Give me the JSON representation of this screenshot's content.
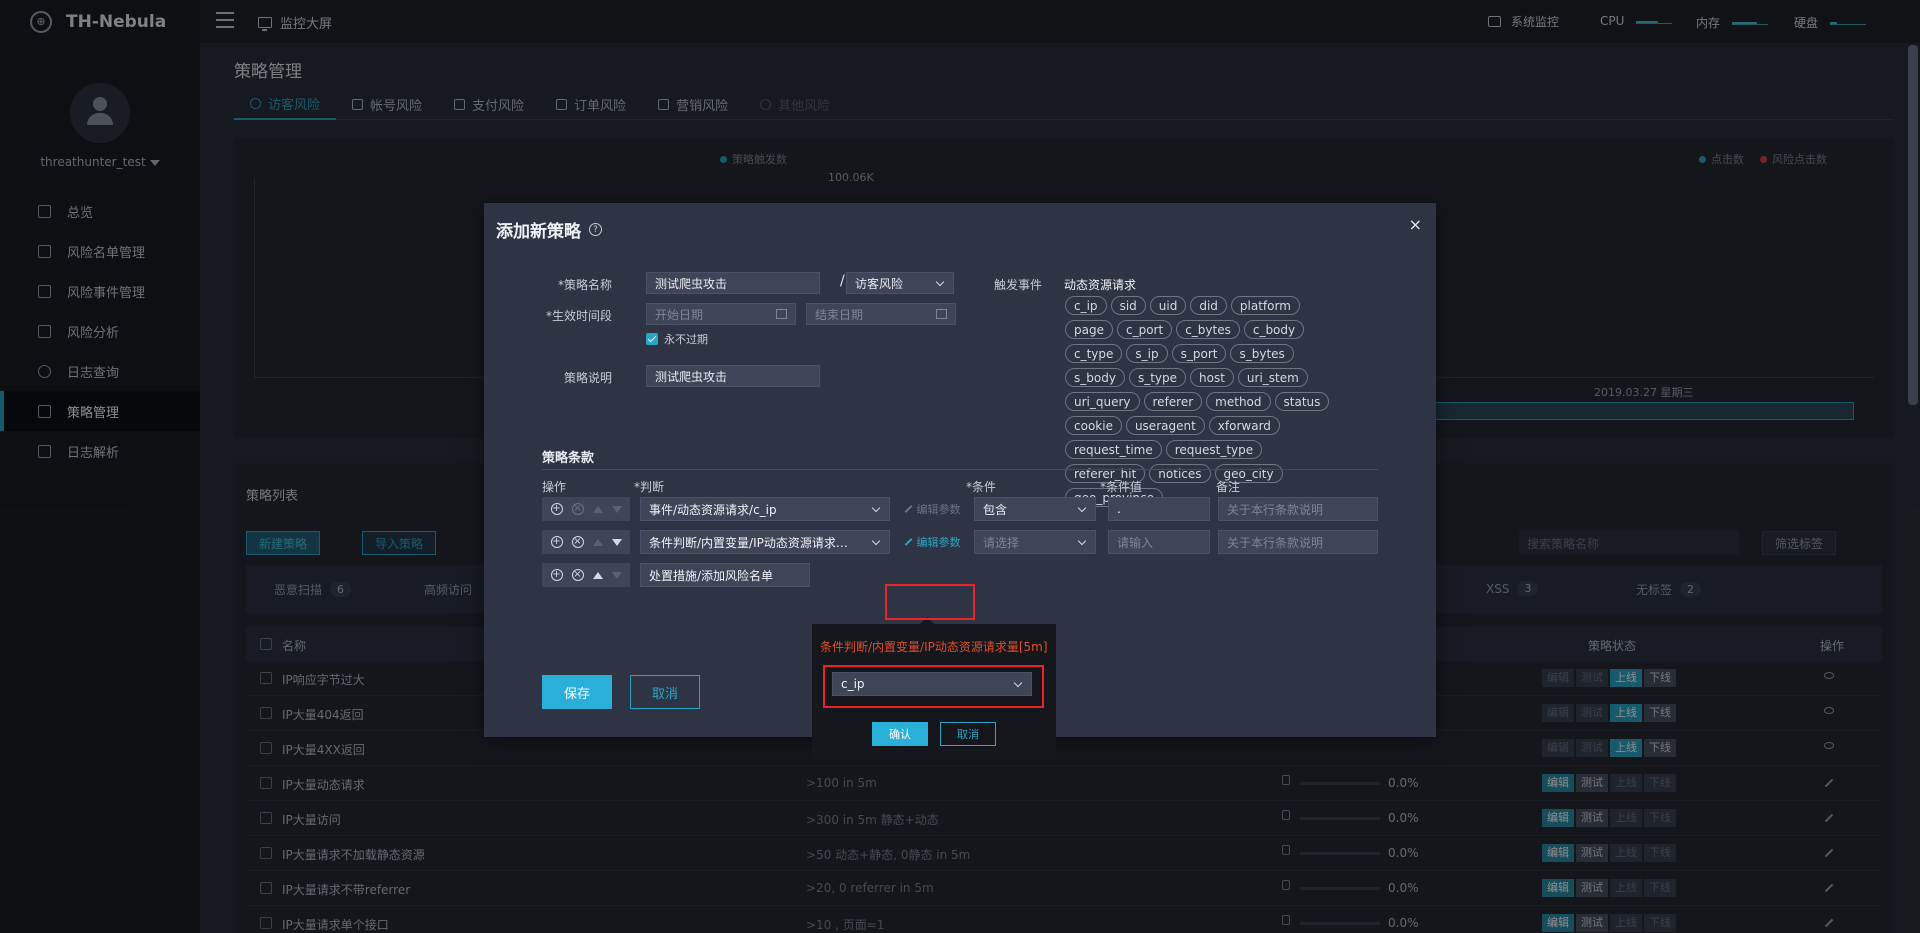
{
  "app": {
    "name": "TH-Nebula",
    "logo_icon": "nebula-logo-icon"
  },
  "topbar": {
    "monitor_screen": "监控大屏",
    "system_monitor": "系统监控",
    "cpu_label": "CPU",
    "memory_label": "内存",
    "disk_label": "硬盘",
    "cpu_usage": 0.6,
    "memory_usage": 0.7,
    "disk_usage": 0.2
  },
  "sidebar": {
    "username": "threathunter_test",
    "items": [
      {
        "label": "总览",
        "icon": "grid-icon"
      },
      {
        "label": "风险名单管理",
        "icon": "image-icon"
      },
      {
        "label": "风险事件管理",
        "icon": "document-icon"
      },
      {
        "label": "风险分析",
        "icon": "chart-icon"
      },
      {
        "label": "日志查询",
        "icon": "search-icon"
      },
      {
        "label": "策略管理",
        "icon": "strategy-icon",
        "active": true
      },
      {
        "label": "日志解析",
        "icon": "file-icon"
      }
    ]
  },
  "page": {
    "title": "策略管理",
    "tabs": [
      {
        "label": "访客风险",
        "icon": "user-icon",
        "active": true
      },
      {
        "label": "帐号风险",
        "icon": "book-icon"
      },
      {
        "label": "支付风险",
        "icon": "card-icon"
      },
      {
        "label": "订单风险",
        "icon": "cart-icon"
      },
      {
        "label": "营销风险",
        "icon": "tag-icon"
      },
      {
        "label": "其他风险",
        "icon": "plus-circle-icon",
        "disabled": true
      }
    ],
    "chart": {
      "legend_left": "策略触发数",
      "legend_click": "点击数",
      "legend_risk": "风险点击数",
      "y_max_label": "100.06K",
      "date_label": "2019.03.27 星期三",
      "colors": {
        "trigger": "#2aa5c6",
        "click": "#2aa5c6",
        "risk": "#d9434b"
      }
    },
    "list": {
      "title": "策略列表",
      "new_btn": "新建策略",
      "import_btn": "导入策略",
      "search_placeholder": "搜索策略名称",
      "filter_btn": "筛选标签",
      "tags": [
        {
          "label": "恶意扫描",
          "count": "6"
        },
        {
          "label": "高频访问",
          "count": ""
        },
        {
          "label": "XSS",
          "count": "3"
        },
        {
          "label": "无标签",
          "count": "2"
        }
      ],
      "col_name": "名称",
      "col_status": "策略状态",
      "col_action": "操作",
      "status_labels": {
        "edit": "编辑",
        "test": "测试",
        "online": "上线",
        "offline": "下线"
      },
      "rows": [
        {
          "name": "IP响应字节过大",
          "rule": "",
          "pct": ""
        },
        {
          "name": "IP大量404返回",
          "rule": "",
          "pct": ""
        },
        {
          "name": "IP大量4XX返回",
          "rule": "",
          "pct": ""
        },
        {
          "name": "IP大量动态请求",
          "rule": ">100 in 5m",
          "pct": "0.0%"
        },
        {
          "name": "IP大量访问",
          "rule": ">300 in 5m 静态+动态",
          "pct": "0.0%"
        },
        {
          "name": "IP大量请求不加载静态资源",
          "rule": ">50 动态+静态, 0静态 in 5m",
          "pct": "0.0%"
        },
        {
          "name": "IP大量请求不带referrer",
          "rule": ">20, 0 referrer in 5m",
          "pct": "0.0%"
        },
        {
          "name": "IP大量请求单个接口",
          "rule": ">10 , 页面=1",
          "pct": "0.0%"
        }
      ]
    }
  },
  "modal": {
    "title": "添加新策略",
    "close": "×",
    "name_label": "*策略名称",
    "name_value": "测试爬虫攻击",
    "category_value": "访客风险",
    "time_label": "*生效时间段",
    "start_placeholder": "开始日期",
    "end_placeholder": "结束日期",
    "never_expire": "永不过期",
    "desc_label": "策略说明",
    "desc_value": "测试爬虫攻击",
    "trigger_label": "触发事件",
    "trigger_value": "动态资源请求",
    "fields": [
      "c_ip",
      "sid",
      "uid",
      "did",
      "platform",
      "page",
      "c_port",
      "c_bytes",
      "c_body",
      "c_type",
      "s_ip",
      "s_port",
      "s_bytes",
      "s_body",
      "s_type",
      "host",
      "uri_stem",
      "uri_query",
      "referer",
      "method",
      "status",
      "cookie",
      "useragent",
      "xforward",
      "request_time",
      "request_type",
      "referer_hit",
      "notices",
      "geo_city",
      "geo_province"
    ],
    "clause_title": "策略条款",
    "col_op": "操作",
    "col_judge": "*判断",
    "col_cond": "*条件",
    "col_value": "*条件值",
    "col_note": "备注",
    "rows": [
      {
        "judge": "事件/动态资源请求/c_ip",
        "edit": "编辑参数",
        "cond": "包含",
        "value": ".",
        "note_placeholder": "关于本行条款说明"
      },
      {
        "judge": "条件判断/内置变量/IP动态资源请求量[5m]",
        "edit": "编辑参数",
        "cond_placeholder": "请选择",
        "value_placeholder": "请输入",
        "note_placeholder": "关于本行条款说明"
      },
      {
        "judge": "处置措施/添加风险名单"
      }
    ],
    "save": "保存",
    "cancel": "取消"
  },
  "popover": {
    "title": "条件判断/内置变量/IP动态资源请求量[5m]",
    "select_value": "c_ip",
    "confirm": "确认",
    "cancel": "取消"
  }
}
